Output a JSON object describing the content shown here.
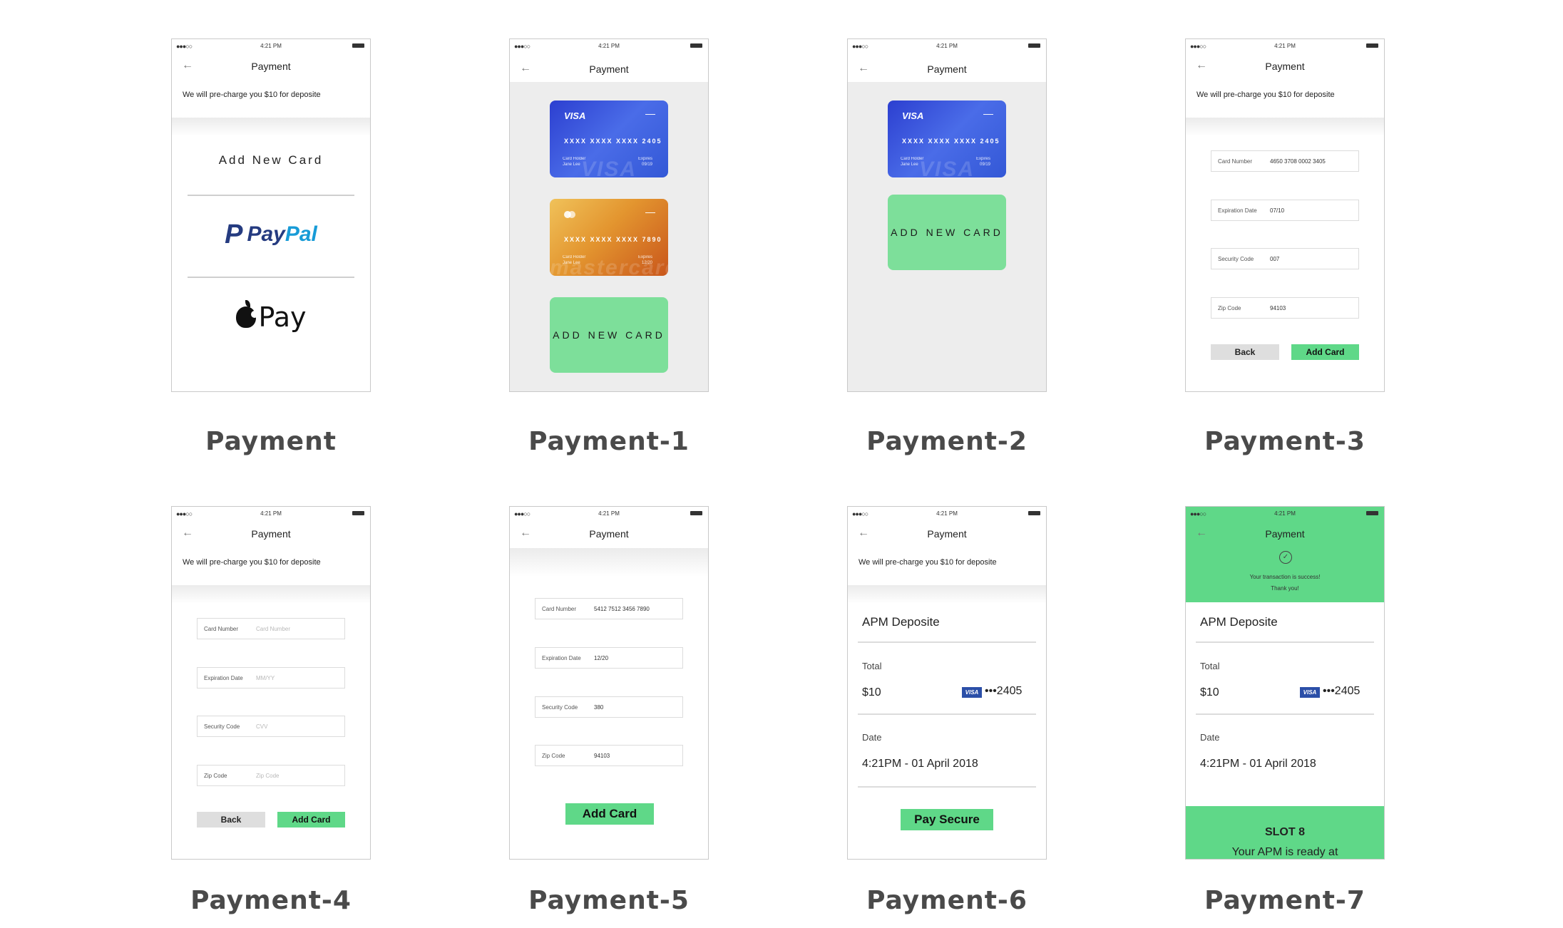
{
  "status": {
    "signal": "●●●○○",
    "time": "4:21 PM"
  },
  "nav": {
    "back": "←",
    "title": "Payment"
  },
  "note": "We will pre-charge you $10 for deposite",
  "captions": [
    "Payment",
    "Payment-1",
    "Payment-2",
    "Payment-3",
    "Payment-4",
    "Payment-5",
    "Payment-6",
    "Payment-7"
  ],
  "payment_methods": {
    "add_new_card": "Add New Card",
    "paypal_a": "Pay",
    "paypal_b": "Pal",
    "paypal_logo": "P",
    "apple_pay": "Pay"
  },
  "cards": {
    "visa": {
      "brand": "VISA",
      "dash": "—",
      "number": "XXXX XXXX XXXX 2405",
      "holder_label": "Card Holder",
      "holder": "Jane Lee",
      "exp_label": "Expires",
      "exp": "09/19",
      "watermark": "VISA"
    },
    "mc": {
      "number": "XXXX XXXX XXXX 7890",
      "holder_label": "Card Holder",
      "holder": "Jane Lee",
      "exp_label": "Expires",
      "exp": "12/20",
      "dash": "—",
      "watermark": "mastercard"
    },
    "add_new_card": "ADD NEW CARD"
  },
  "form": {
    "labels": {
      "card_number": "Card Number",
      "expiration": "Expiration Date",
      "security": "Security Code",
      "zip": "Zip Code"
    },
    "filled3": {
      "card_number": "4650 3708 0002 3405",
      "expiration": "07/10",
      "security": "007",
      "zip": "94103"
    },
    "placeholders": {
      "card_number": "Card Number",
      "expiration": "MM/YY",
      "security": "CVV",
      "zip": "Zip Code"
    },
    "filled5": {
      "card_number": "5412 7512 3456 7890",
      "expiration": "12/20",
      "security": "380",
      "zip": "94103"
    },
    "back": "Back",
    "add_card": "Add Card"
  },
  "summary": {
    "title": "APM Deposite",
    "total_label": "Total",
    "total": "$10",
    "visa": "VISA",
    "last4": "•••2405",
    "date_label": "Date",
    "date": "4:21PM - 01 April 2018",
    "pay_secure": "Pay Secure"
  },
  "success": {
    "line1": "Your transaction is success!",
    "line2": "Thank you!",
    "check": "✓",
    "ready_prefix": "Your APM is ready at ",
    "ready_slot": "SLOT 8"
  },
  "colors": {
    "green": "#5fd888",
    "green_light": "#7ddf9a",
    "visa_blue": "#2c3fd0",
    "mc_orange": "#e3952f"
  }
}
